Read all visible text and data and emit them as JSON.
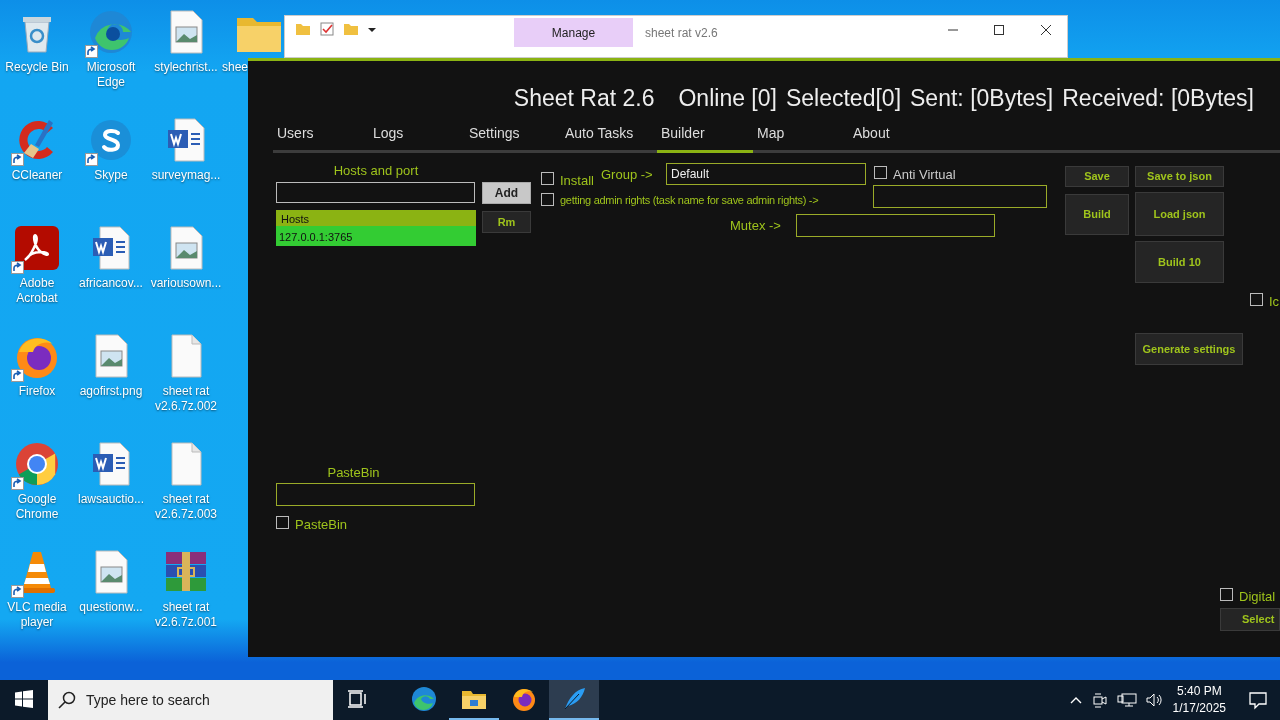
{
  "desktop": {
    "icons": [
      {
        "label": "Recycle Bin",
        "kind": "recycle",
        "shortcut": false
      },
      {
        "label": "CCleaner",
        "kind": "ccleaner",
        "shortcut": true
      },
      {
        "label": "Adobe Acrobat",
        "kind": "acrobat",
        "shortcut": true
      },
      {
        "label": "Firefox",
        "kind": "firefox",
        "shortcut": true
      },
      {
        "label": "Google Chrome",
        "kind": "chrome",
        "shortcut": true
      },
      {
        "label": "VLC media player",
        "kind": "vlc",
        "shortcut": true
      },
      {
        "label": "Microsoft Edge",
        "kind": "edge",
        "shortcut": true
      },
      {
        "label": "Skype",
        "kind": "skype",
        "shortcut": true
      },
      {
        "label": "africancov...",
        "kind": "word",
        "shortcut": false
      },
      {
        "label": "agofirst.png",
        "kind": "image",
        "shortcut": false
      },
      {
        "label": "lawsauctio...",
        "kind": "word",
        "shortcut": false
      },
      {
        "label": "questionw...",
        "kind": "image",
        "shortcut": false
      },
      {
        "label": "stylechrist...",
        "kind": "image",
        "shortcut": false
      },
      {
        "label": "surveymag...",
        "kind": "word",
        "shortcut": false
      },
      {
        "label": "variousown...",
        "kind": "image",
        "shortcut": false
      },
      {
        "label": "sheet rat v2.6.7z.002",
        "kind": "blank",
        "shortcut": false
      },
      {
        "label": "sheet rat v2.6.7z.003",
        "kind": "blank",
        "shortcut": false
      },
      {
        "label": "sheet rat v2.6.7z.001",
        "kind": "rar",
        "shortcut": false
      },
      {
        "label": "shee",
        "kind": "folder",
        "shortcut": false
      }
    ]
  },
  "explorer": {
    "title": "sheet rat v2.6",
    "context_tab": "Manage"
  },
  "app": {
    "title": "Sheet Rat 2.6",
    "stats": [
      "Online [0]",
      "Selected[0]",
      "Sent: [0Bytes]",
      "Received: [0Bytes]"
    ],
    "tabs": [
      {
        "label": "Users",
        "selected": false
      },
      {
        "label": "Logs",
        "selected": false
      },
      {
        "label": "Settings",
        "selected": false
      },
      {
        "label": "Auto Tasks",
        "selected": false
      },
      {
        "label": "Builder",
        "selected": true
      },
      {
        "label": "Map",
        "selected": false
      },
      {
        "label": "About",
        "selected": false
      }
    ],
    "builder": {
      "hosts_label": "Hosts and port",
      "add_button": "Add",
      "remove_button": "Rm",
      "hosts_list": {
        "header": "Hosts",
        "rows": [
          "127.0.0.1:3765"
        ]
      },
      "install": {
        "label": "Install",
        "checked": false
      },
      "group_label": "Group ->",
      "group_value": "Default",
      "anti_virtual": {
        "label": "Anti Virtual",
        "checked": false
      },
      "admin_rights": {
        "label": "getting admin rights (task name for save admin rights) ->",
        "checked": false
      },
      "mutex_label": "Mutex ->",
      "buttons": [
        {
          "label": "Save"
        },
        {
          "label": "Save to json"
        },
        {
          "label": "Build"
        },
        {
          "label": "Load json"
        },
        {
          "label": "Build 10"
        },
        {
          "label": "Generate settings"
        }
      ],
      "icon_option": {
        "label": "Ic",
        "checked": false
      },
      "pastebin_label": "PasteBin",
      "pastebin_option": {
        "label": "PasteBin",
        "checked": false
      },
      "digital_signature": {
        "label": "Digital",
        "checked": false
      },
      "select_button": "Select"
    }
  },
  "taskbar": {
    "search_placeholder": "Type here to search",
    "apps": [
      {
        "kind": "edge",
        "running": false,
        "selected": false
      },
      {
        "kind": "explorer",
        "running": true,
        "selected": false
      },
      {
        "kind": "firefox",
        "running": false,
        "selected": false
      },
      {
        "kind": "feather",
        "running": true,
        "selected": true
      }
    ],
    "time": "5:40 PM",
    "date": "1/17/2025"
  }
}
